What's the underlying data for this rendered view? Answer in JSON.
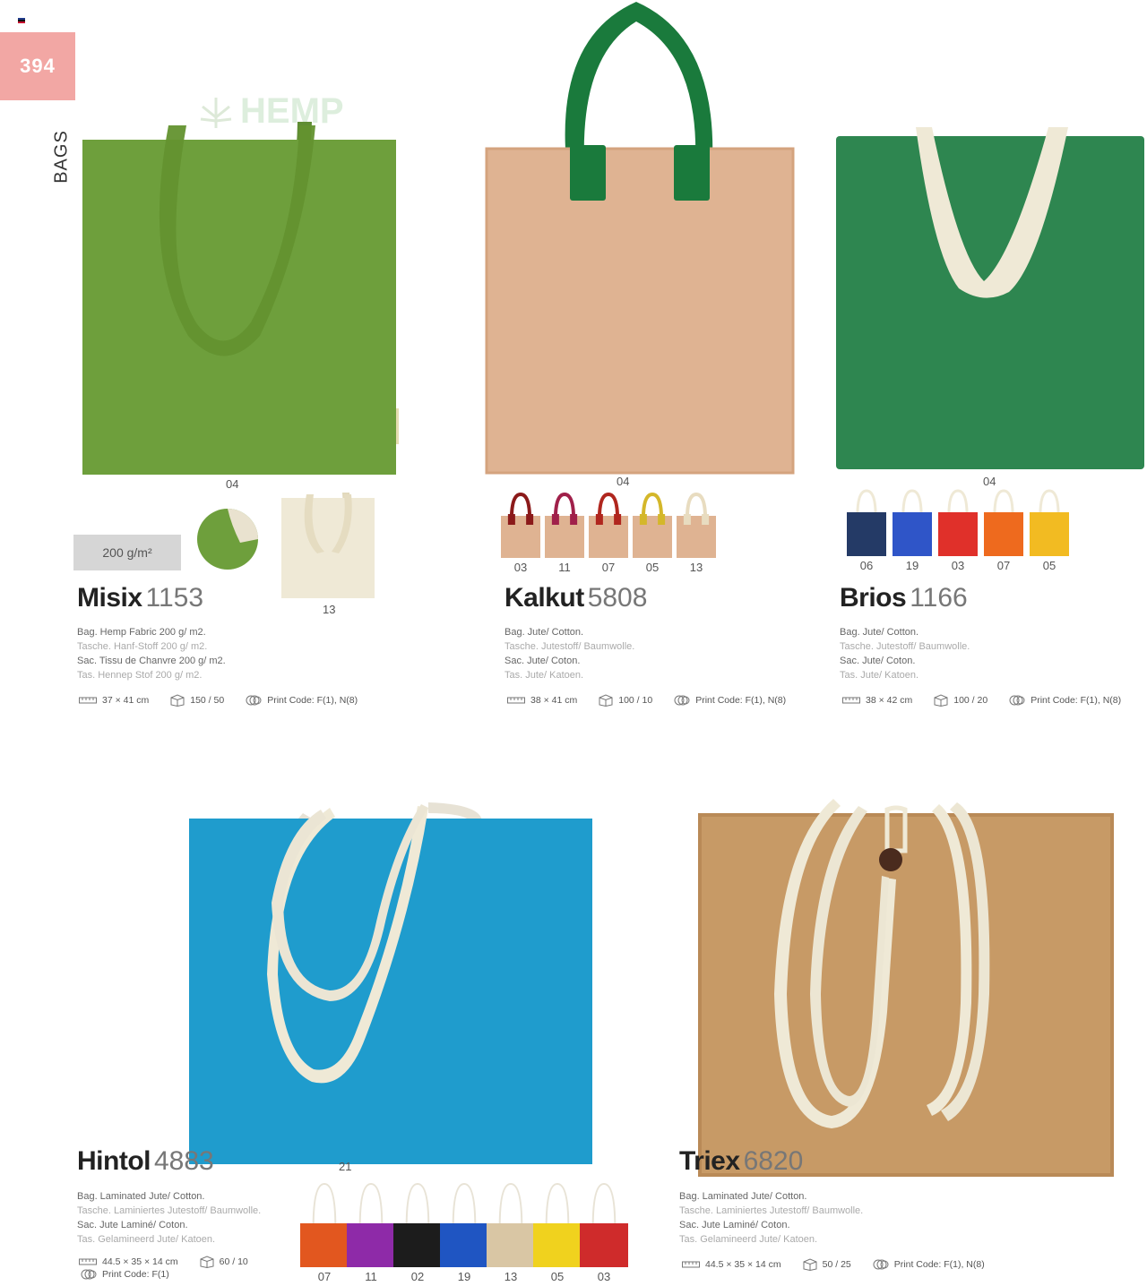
{
  "page_number": "394",
  "section": "BAGS",
  "weight_badge": "200 g/m²",
  "hemp_logo": "HEMP",
  "products": {
    "misix": {
      "name": "Misix",
      "ref": "1153",
      "main_code": "04",
      "alt_code": "13",
      "desc": [
        "Bag. Hemp Fabric 200 g/ m2.",
        "Tasche. Hanf-Stoff 200 g/ m2.",
        "Sac. Tissu de Chanvre 200 g/ m2.",
        "Tas. Hennep Stof 200 g/ m2."
      ],
      "size": "37 × 41 cm",
      "pack": "150 / 50",
      "print": "Print Code: F(1), N(8)"
    },
    "kalkut": {
      "name": "Kalkut",
      "ref": "5808",
      "main_code": "04",
      "variants": [
        "03",
        "11",
        "07",
        "05",
        "13"
      ],
      "variant_colors": [
        "#8b1a1a",
        "#a0204a",
        "#b0261e",
        "#d4b72a",
        "#e8dcc0"
      ],
      "desc": [
        "Bag. Jute/ Cotton.",
        "Tasche. Jutestoff/ Baumwolle.",
        "Sac. Jute/ Coton.",
        "Tas. Jute/ Katoen."
      ],
      "size": "38 × 41 cm",
      "pack": "100 / 10",
      "print": "Print Code: F(1), N(8)"
    },
    "brios": {
      "name": "Brios",
      "ref": "1166",
      "main_code": "04",
      "variants": [
        "06",
        "19",
        "03",
        "07",
        "05"
      ],
      "variant_colors": [
        "#243a66",
        "#2f55c8",
        "#e0302a",
        "#ee6a1e",
        "#f2bb22"
      ],
      "desc": [
        "Bag. Jute/ Cotton.",
        "Tasche. Jutestoff/ Baumwolle.",
        "Sac. Jute/ Coton.",
        "Tas. Jute/ Katoen."
      ],
      "size": "38 × 42 cm",
      "pack": "100 / 20",
      "print": "Print Code: F(1), N(8)"
    },
    "hintol": {
      "name": "Hintol",
      "ref": "4883",
      "main_code": "21",
      "variants": [
        "07",
        "11",
        "02",
        "19",
        "13",
        "05",
        "03"
      ],
      "variant_colors": [
        "#e2571f",
        "#8e2aa8",
        "#1c1c1c",
        "#1f55c2",
        "#d9c6a4",
        "#f0d21e",
        "#cf2b2b"
      ],
      "desc": [
        "Bag. Laminated Jute/ Cotton.",
        "Tasche. Laminiertes Jutestoff/ Baumwolle.",
        "Sac. Jute Laminé/ Coton.",
        "Tas. Gelamineerd Jute/ Katoen."
      ],
      "size": "44.5 × 35 × 14 cm",
      "pack": "60 / 10",
      "print": "Print Code: F(1)"
    },
    "triex": {
      "name": "Triex",
      "ref": "6820",
      "desc": [
        "Bag. Laminated Jute/ Cotton.",
        "Tasche. Laminiertes Jutestoff/ Baumwolle.",
        "Sac. Jute Laminé/ Coton.",
        "Tas. Gelamineerd Jute/ Katoen."
      ],
      "size": "44.5 × 35 × 14 cm",
      "pack": "50 / 25",
      "print": "Print Code: F(1), N(8)"
    }
  },
  "colors": {
    "badge": "#f2a7a4",
    "misix_bag": "#6e9f3c",
    "kalkut_bag": "#dfb392",
    "kalkut_handle": "#1a7a3c",
    "brios_bag": "#2e8650",
    "hintol_bag": "#1f9ccd",
    "triex_bag": "#c79a66",
    "cream": "#efe9d6"
  },
  "icons": [
    "ruler-icon",
    "box-icon",
    "print-icon"
  ]
}
